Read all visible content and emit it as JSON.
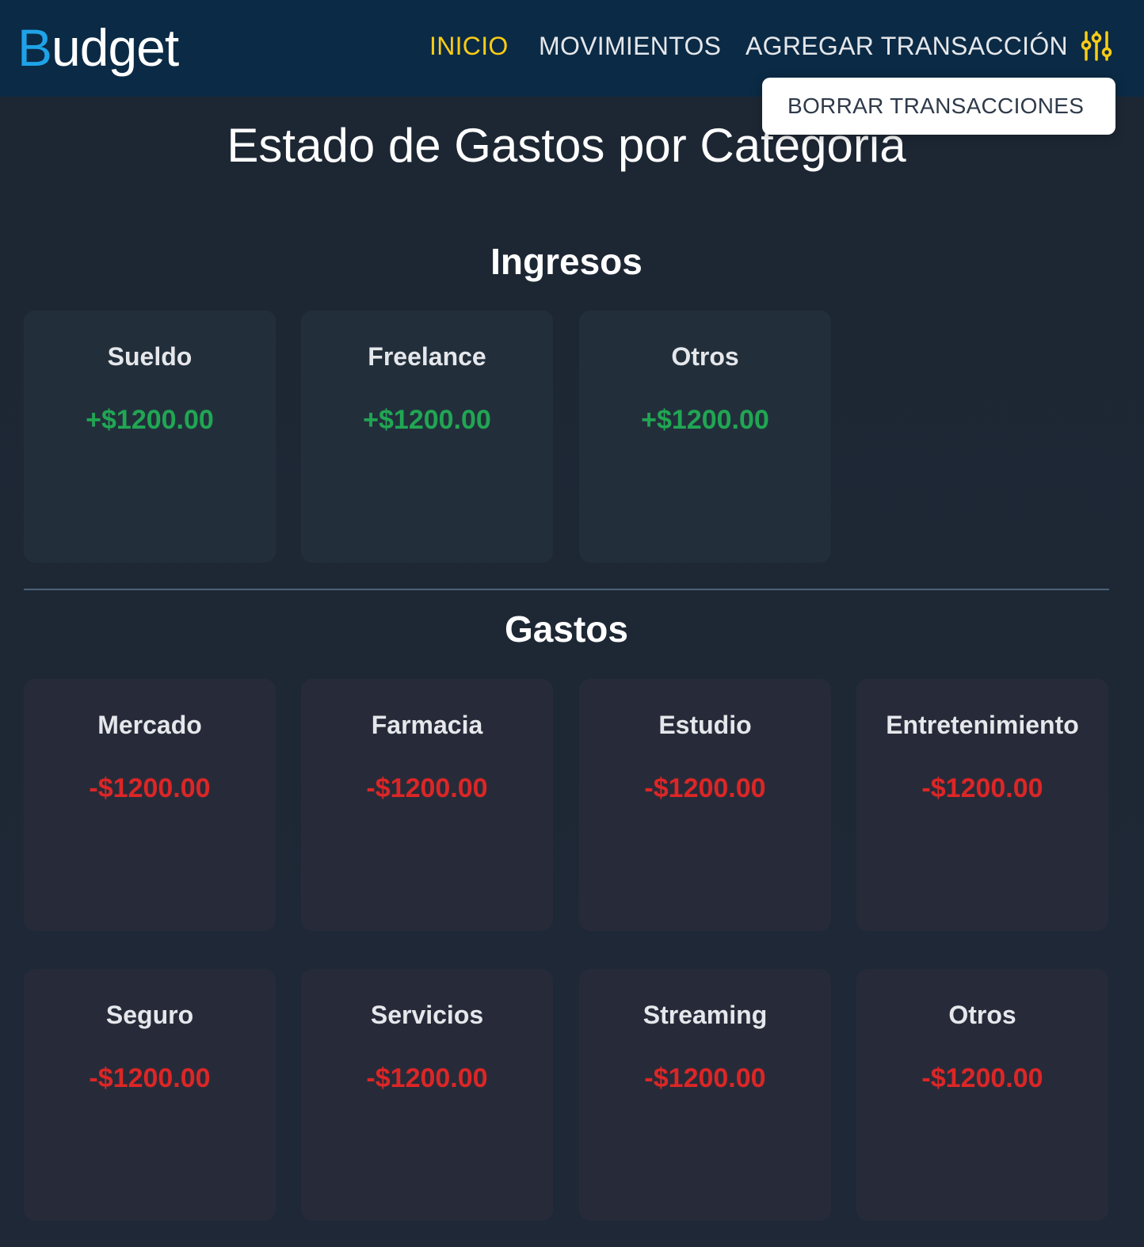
{
  "header": {
    "logo_first": "B",
    "logo_rest": "udget",
    "nav": [
      {
        "label": "INICIO",
        "active": true
      },
      {
        "label": "MOVIMIENTOS",
        "active": false
      },
      {
        "label": "AGREGAR TRANSACCIÓN",
        "active": false
      }
    ],
    "settings_icon": "sliders-icon"
  },
  "dropdown": {
    "items": [
      {
        "label": "BORRAR TRANSACCIONES"
      }
    ]
  },
  "main": {
    "title": "Estado de Gastos por Categoria",
    "income": {
      "title": "Ingresos",
      "cards": [
        {
          "name": "Sueldo",
          "amount": "+$1200.00"
        },
        {
          "name": "Freelance",
          "amount": "+$1200.00"
        },
        {
          "name": "Otros",
          "amount": "+$1200.00"
        }
      ]
    },
    "expenses": {
      "title": "Gastos",
      "cards": [
        {
          "name": "Mercado",
          "amount": "-$1200.00"
        },
        {
          "name": "Farmacia",
          "amount": "-$1200.00"
        },
        {
          "name": "Estudio",
          "amount": "-$1200.00"
        },
        {
          "name": "Entretenimiento",
          "amount": "-$1200.00"
        },
        {
          "name": "Seguro",
          "amount": "-$1200.00"
        },
        {
          "name": "Servicios",
          "amount": "-$1200.00"
        },
        {
          "name": "Streaming",
          "amount": "-$1200.00"
        },
        {
          "name": "Otros",
          "amount": "-$1200.00"
        }
      ]
    }
  },
  "colors": {
    "brand": "#1fa3e8",
    "nav_active": "#facc15",
    "income": "#21a653",
    "expense": "#dc2626",
    "navbar_bg": "#0b2a45",
    "page_bg": "#1e2836"
  }
}
